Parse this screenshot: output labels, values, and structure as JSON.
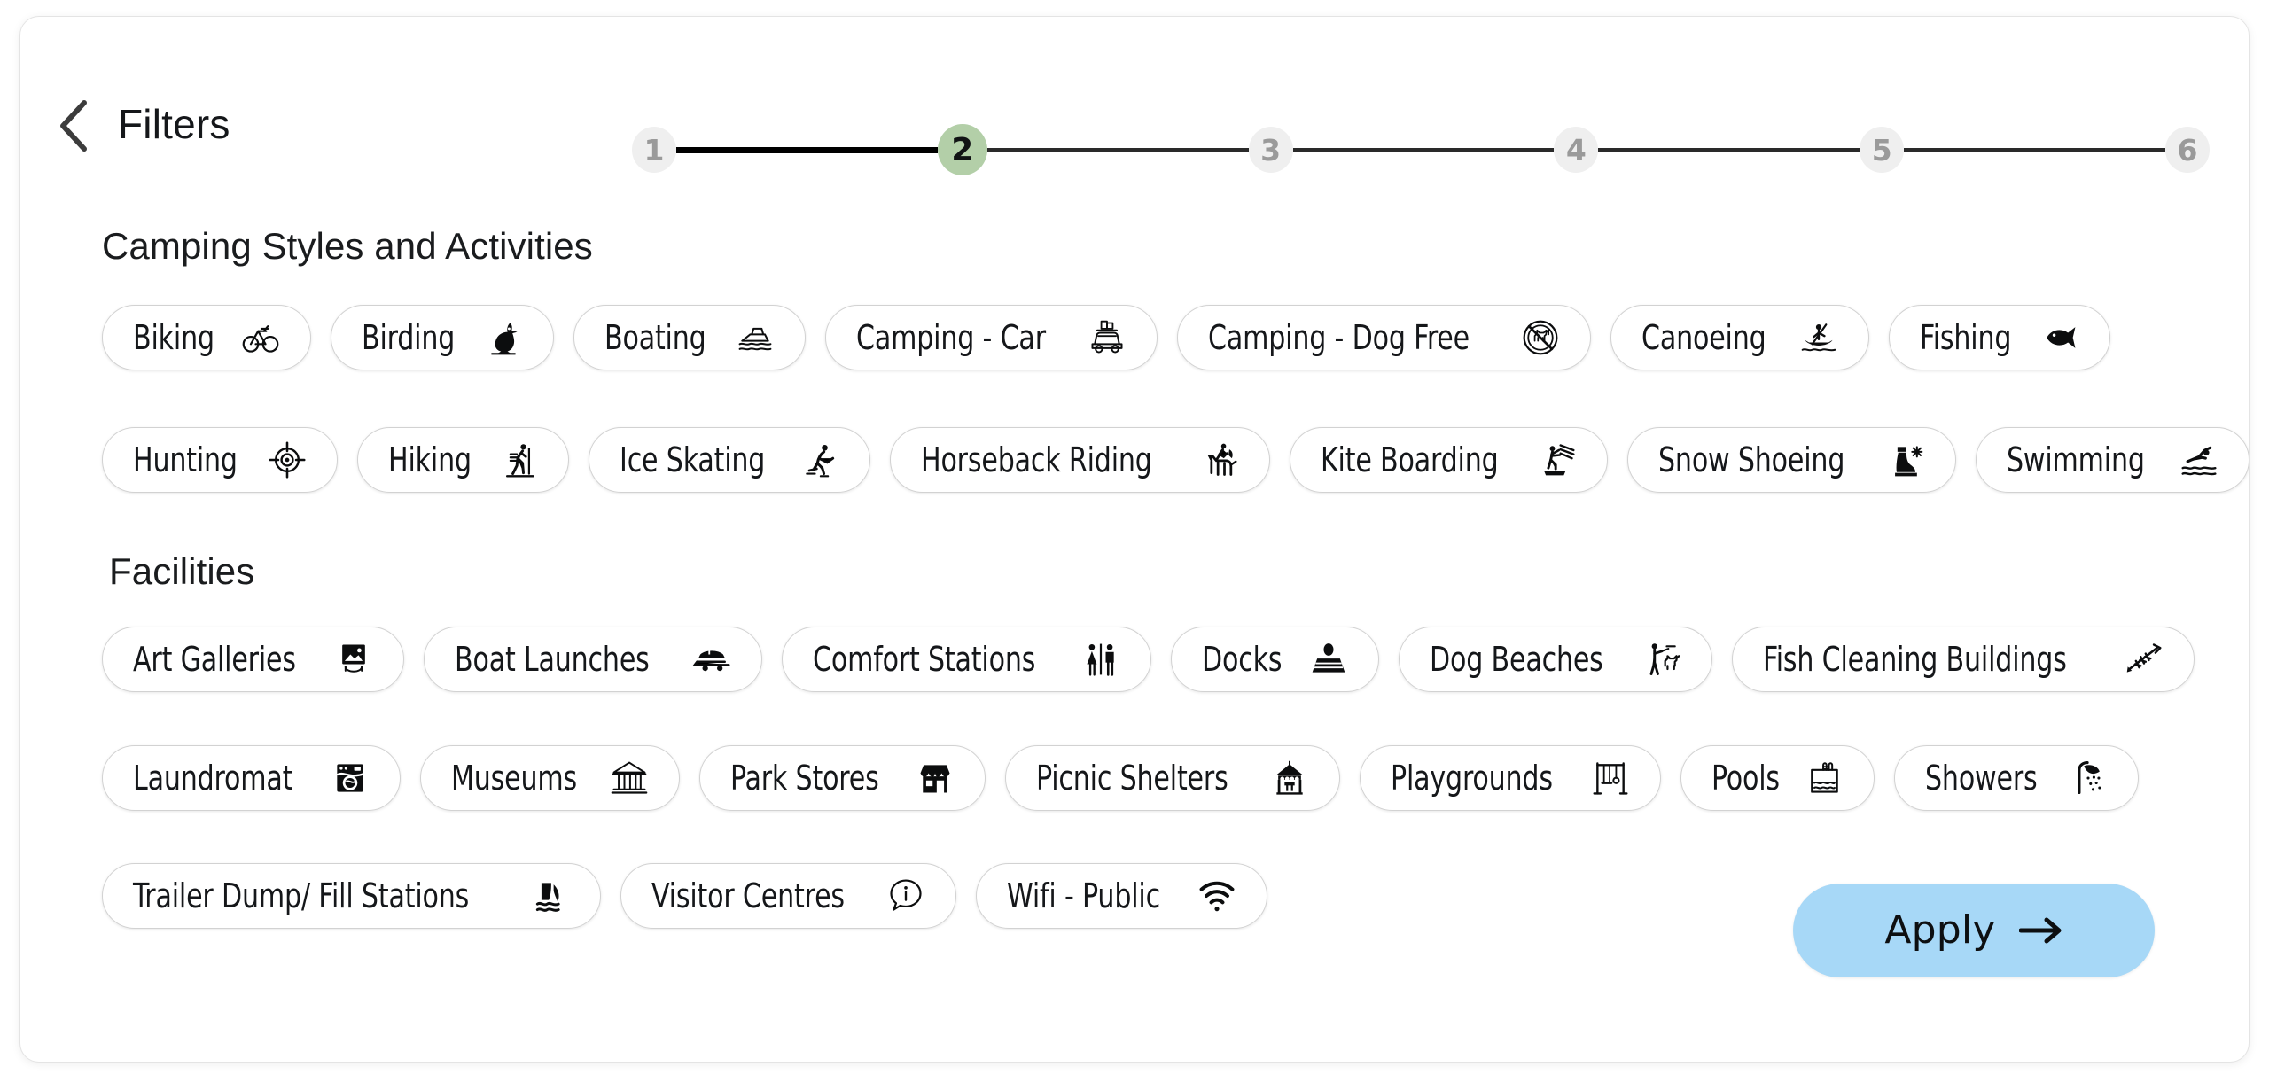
{
  "header": {
    "title": "Filters",
    "back_icon": "chevron-left-icon"
  },
  "stepper": {
    "current_step": 2,
    "total_steps": 6,
    "steps": [
      {
        "label": "1",
        "state": "complete"
      },
      {
        "label": "2",
        "state": "active"
      },
      {
        "label": "3",
        "state": "upcoming"
      },
      {
        "label": "4",
        "state": "upcoming"
      },
      {
        "label": "5",
        "state": "upcoming"
      },
      {
        "label": "6",
        "state": "upcoming"
      }
    ],
    "active_color": "#b3cfa8",
    "inactive_color": "#efefef",
    "connector_color": "#2a2a2a"
  },
  "sections": [
    {
      "id": "camping",
      "heading": "Camping Styles and Activities",
      "rows": [
        [
          {
            "label": "Biking",
            "icon": "bicycle-icon"
          },
          {
            "label": "Birding",
            "icon": "bird-icon"
          },
          {
            "label": "Boating",
            "icon": "motorboat-icon"
          },
          {
            "label": "Camping - Car",
            "icon": "loaded-car-icon"
          },
          {
            "label": "Camping - Dog Free",
            "icon": "no-dogs-icon"
          },
          {
            "label": "Canoeing",
            "icon": "canoe-icon"
          },
          {
            "label": "Fishing",
            "icon": "fish-icon"
          }
        ],
        [
          {
            "label": "Hunting",
            "icon": "target-crosshair-icon"
          },
          {
            "label": "Hiking",
            "icon": "hiker-icon"
          },
          {
            "label": "Ice Skating",
            "icon": "ice-skater-icon"
          },
          {
            "label": "Horseback Riding",
            "icon": "horse-rider-icon"
          },
          {
            "label": "Kite Boarding",
            "icon": "kite-boarder-icon"
          },
          {
            "label": "Snow Shoeing",
            "icon": "snow-boot-icon"
          },
          {
            "label": "Swimming",
            "icon": "swimmer-icon"
          }
        ]
      ]
    },
    {
      "id": "facilities",
      "heading": "Facilities",
      "rows": [
        [
          {
            "label": "Art Galleries",
            "icon": "picture-frame-icon"
          },
          {
            "label": "Boat Launches",
            "icon": "boat-trailer-icon"
          },
          {
            "label": "Comfort Stations",
            "icon": "restroom-icon"
          },
          {
            "label": "Docks",
            "icon": "dock-icon"
          },
          {
            "label": "Dog Beaches",
            "icon": "person-with-dog-icon"
          },
          {
            "label": "Fish Cleaning Buildings",
            "icon": "fish-bone-icon"
          }
        ],
        [
          {
            "label": "Laundromat",
            "icon": "washing-machine-icon"
          },
          {
            "label": "Museums",
            "icon": "museum-building-icon"
          },
          {
            "label": "Park Stores",
            "icon": "storefront-icon"
          },
          {
            "label": "Picnic Shelters",
            "icon": "gazebo-icon"
          },
          {
            "label": "Playgrounds",
            "icon": "swing-set-icon"
          },
          {
            "label": "Pools",
            "icon": "swimming-pool-icon"
          },
          {
            "label": "Showers",
            "icon": "shower-head-icon"
          }
        ],
        [
          {
            "label": "Trailer Dump/ Fill Stations",
            "icon": "dump-station-icon"
          },
          {
            "label": "Visitor Centres",
            "icon": "info-bubble-icon"
          },
          {
            "label": "Wifi - Public",
            "icon": "wifi-icon"
          }
        ]
      ]
    }
  ],
  "apply": {
    "label": "Apply",
    "icon": "arrow-right-icon",
    "color": "#a7d8f7"
  }
}
